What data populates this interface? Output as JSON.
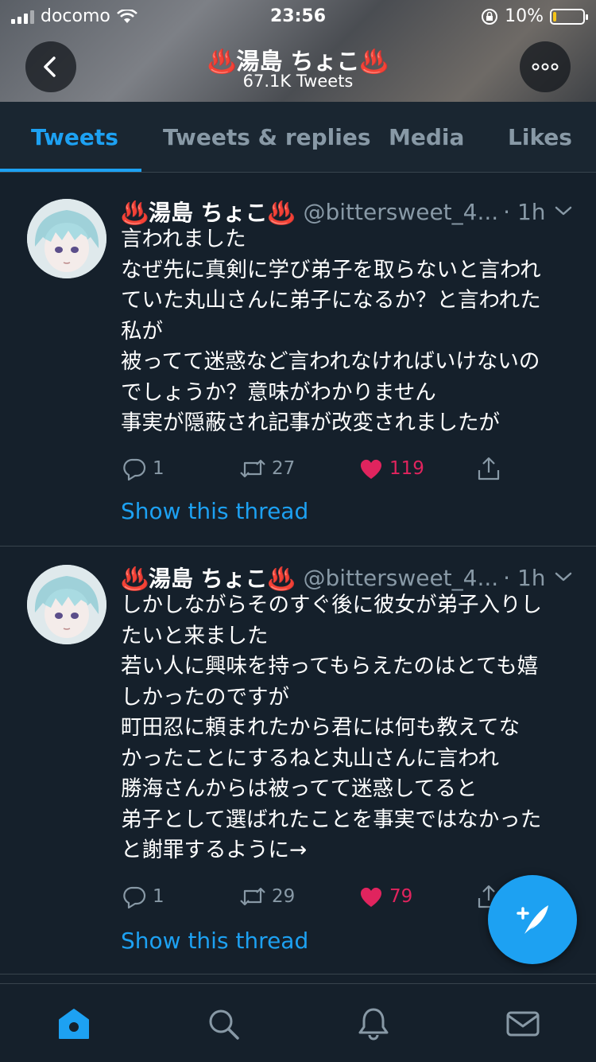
{
  "status": {
    "carrier": "docomo",
    "time": "23:56",
    "battery": "10%",
    "battery_level": 0.1
  },
  "header": {
    "title": "♨️湯島 ちょこ♨️",
    "subtitle": "67.1K Tweets",
    "back_icon": "chevron-left-icon",
    "more_icon": "ellipsis-icon"
  },
  "tabs": [
    {
      "label": "Tweets",
      "active": true
    },
    {
      "label": "Tweets & replies",
      "active": false
    },
    {
      "label": "Media",
      "active": false
    },
    {
      "label": "Likes",
      "active": false
    }
  ],
  "tweets": [
    {
      "name": "♨️湯島 ちょこ♨️",
      "handle": "@bittersweet_4...",
      "time": "· 1h",
      "lines": [
        "言われました",
        "なぜ先に真剣に学び弟子を取らないと言われ",
        "ていた丸山さんに弟子になるか？と言われた",
        "私が",
        "被ってて迷惑など言われなければいけないの",
        "でしょうか？意味がわかりません",
        "事実が隠蔽され記事が改変されましたが"
      ],
      "replies": "1",
      "retweets": "27",
      "likes": "119",
      "show_thread": "Show this thread"
    },
    {
      "name": "♨️湯島 ちょこ♨️",
      "handle": "@bittersweet_4...",
      "time": "· 1h",
      "lines": [
        "しかしながらそのすぐ後に彼女が弟子入りし",
        "たいと来ました",
        "若い人に興味を持ってもらえたのはとても嬉",
        "しかったのですが",
        "町田忍に頼まれたから君には何も教えてな",
        "かったことにするねと丸山さんに言われ",
        "勝海さんからは被ってて迷惑してると",
        "弟子として選ばれたことを事実ではなかった",
        "と謝罪するように→"
      ],
      "replies": "1",
      "retweets": "29",
      "likes": "79",
      "show_thread": "Show this thread"
    }
  ],
  "colors": {
    "background": "#15202b",
    "accent": "#1da1f2",
    "like": "#e0245e",
    "muted": "#8899a6"
  },
  "bottom_nav": [
    "home-icon",
    "search-icon",
    "notifications-icon",
    "messages-icon"
  ],
  "fab_icon": "compose-tweet-icon"
}
